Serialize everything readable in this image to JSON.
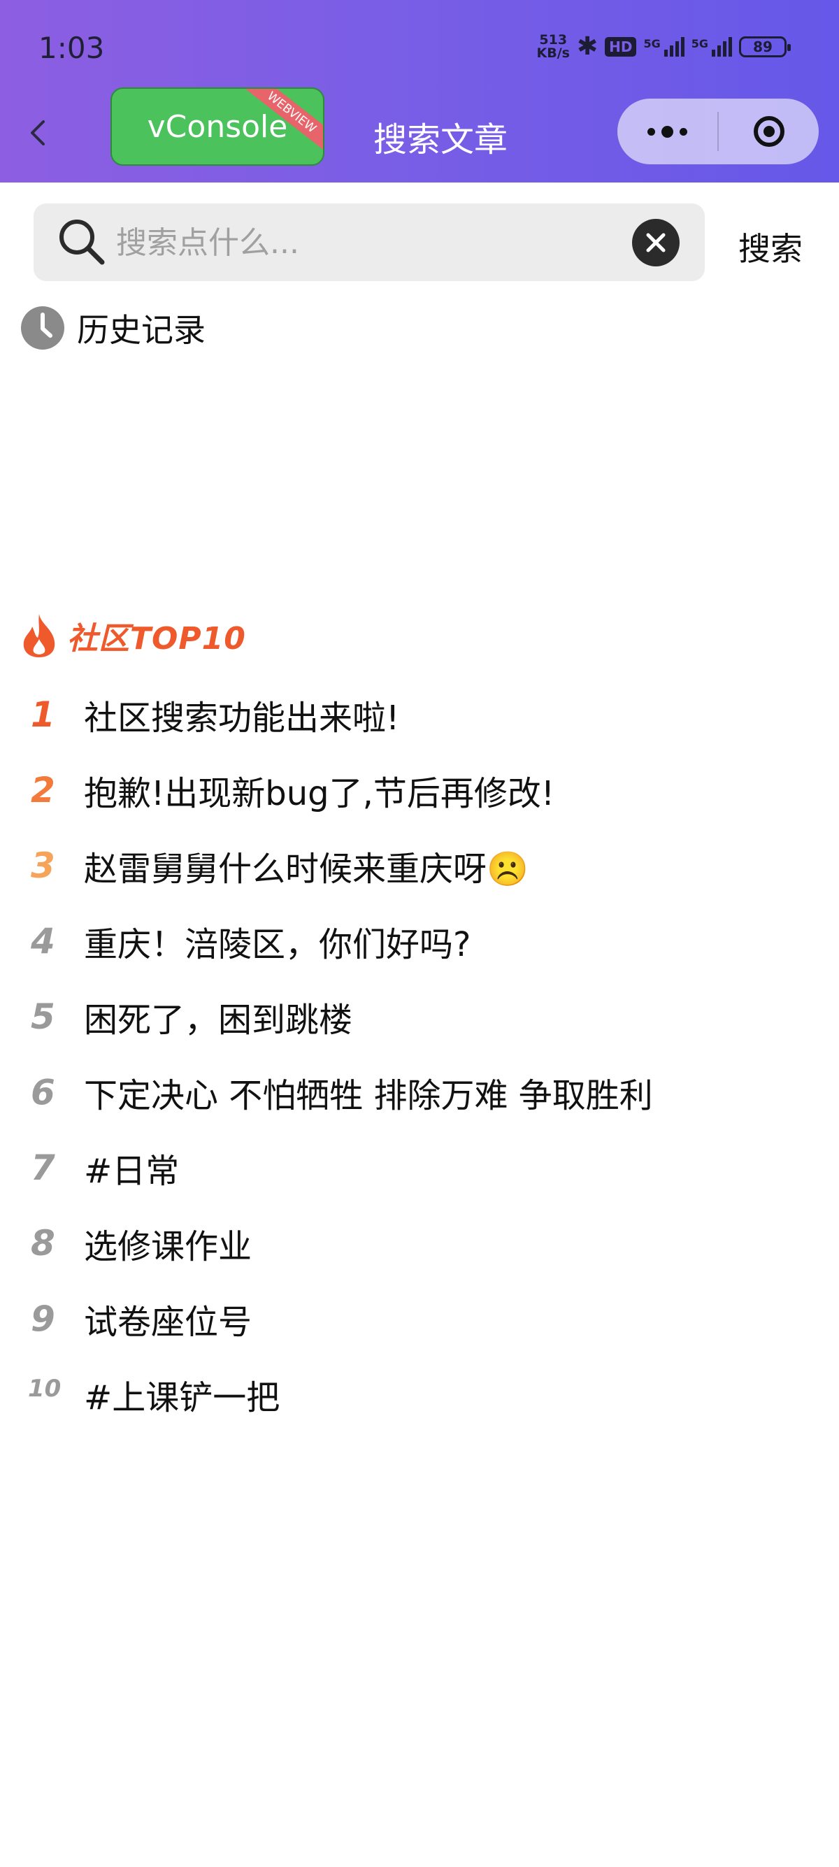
{
  "status_bar": {
    "time": "1:03",
    "speed_value": "513",
    "speed_unit": "KB/s",
    "hd_badge": "HD",
    "sim1_label": "5G",
    "sim2_label": "5G",
    "battery_level": "89"
  },
  "nav": {
    "vconsole_label": "vConsole",
    "vconsole_ribbon": "WEBVIEW",
    "title": "搜索文章"
  },
  "search": {
    "placeholder": "搜索点什么...",
    "value": "",
    "button_label": "搜索"
  },
  "history": {
    "label": "历史记录"
  },
  "top": {
    "title": "社区TOP10",
    "items": [
      {
        "rank": "1",
        "text": "社区搜索功能出来啦!",
        "color": "#ee5a2c"
      },
      {
        "rank": "2",
        "text": "抱歉!出现新bug了,节后再修改!",
        "color": "#f27b3c"
      },
      {
        "rank": "3",
        "text": "赵雷舅舅什么时候来重庆呀☹️",
        "color": "#f5a45a"
      },
      {
        "rank": "4",
        "text": "重庆！涪陵区，你们好吗?",
        "color": "#9a9a9a"
      },
      {
        "rank": "5",
        "text": "困死了，困到跳楼",
        "color": "#9a9a9a"
      },
      {
        "rank": "6",
        "text": "下定决心 不怕牺牲 排除万难 争取胜利",
        "color": "#9a9a9a"
      },
      {
        "rank": "7",
        "text": "#日常",
        "color": "#9a9a9a"
      },
      {
        "rank": "8",
        "text": "选修课作业",
        "color": "#9a9a9a"
      },
      {
        "rank": "9",
        "text": "试卷座位号",
        "color": "#9a9a9a"
      },
      {
        "rank": "10",
        "text": "#上课铲一把",
        "color": "#9a9a9a"
      }
    ]
  },
  "colors": {
    "header_gradient_start": "#8d5ee1",
    "header_gradient_end": "#6658e8",
    "vconsole_green": "#4bc25b",
    "accent_orange": "#ee5a2c"
  }
}
